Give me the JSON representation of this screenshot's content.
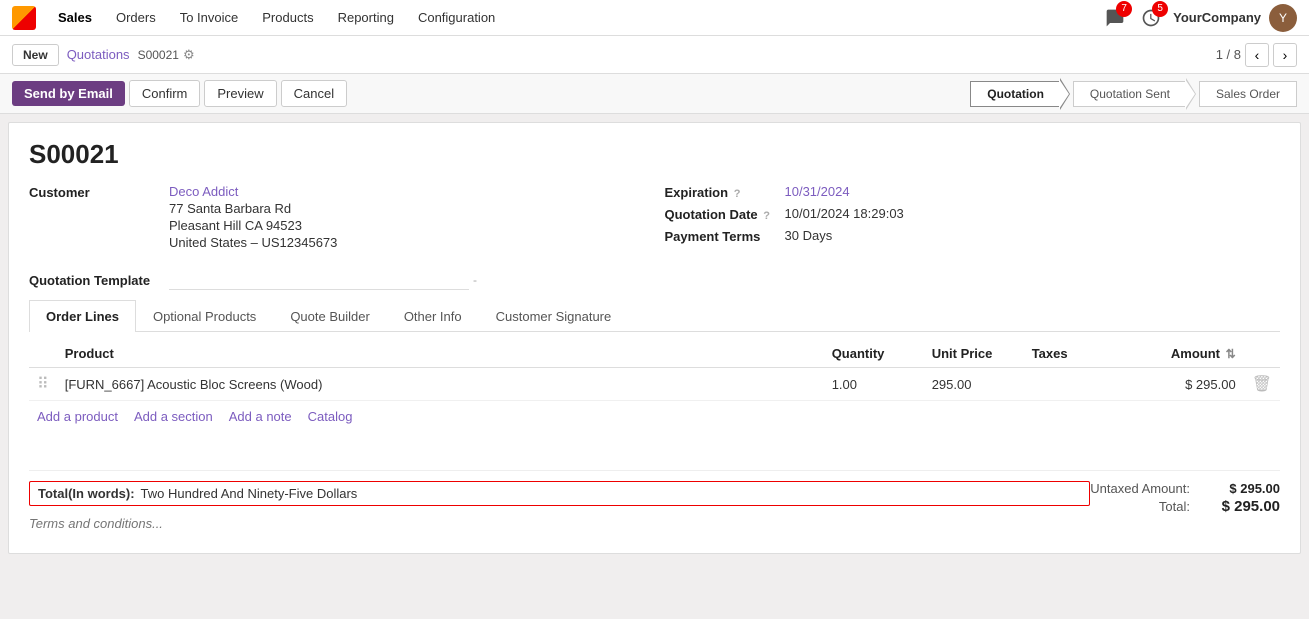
{
  "app": {
    "logo_alt": "Odoo",
    "nav_items": [
      {
        "label": "Sales",
        "active": true
      },
      {
        "label": "Orders"
      },
      {
        "label": "To Invoice"
      },
      {
        "label": "Products"
      },
      {
        "label": "Reporting"
      },
      {
        "label": "Configuration"
      }
    ],
    "notification_badge": "7",
    "clock_badge": "5",
    "company": "YourCompany",
    "avatar_initials": "Y"
  },
  "breadcrumb": {
    "new_label": "New",
    "parent_label": "Quotations",
    "current_id": "S00021",
    "gear_symbol": "⚙"
  },
  "pagination": {
    "current": "1 / 8",
    "prev": "‹",
    "next": "›"
  },
  "actions": {
    "send_by_email": "Send by Email",
    "confirm": "Confirm",
    "preview": "Preview",
    "cancel": "Cancel"
  },
  "status_steps": [
    {
      "label": "Quotation",
      "active": true
    },
    {
      "label": "Quotation Sent",
      "active": false
    },
    {
      "label": "Sales Order",
      "active": false
    }
  ],
  "form": {
    "title": "S00021",
    "customer_label": "Customer",
    "customer_name": "Deco Addict",
    "customer_address1": "77 Santa Barbara Rd",
    "customer_address2": "Pleasant Hill CA 94523",
    "customer_address3": "United States – US12345673",
    "expiration_label": "Expiration",
    "expiration_help": "?",
    "expiration_value": "10/31/2024",
    "quotation_date_label": "Quotation Date",
    "quotation_date_help": "?",
    "quotation_date_value": "10/01/2024 18:29:03",
    "payment_terms_label": "Payment Terms",
    "payment_terms_value": "30 Days",
    "template_label": "Quotation Template",
    "template_placeholder": "-"
  },
  "tabs": [
    {
      "label": "Order Lines",
      "active": true
    },
    {
      "label": "Optional Products",
      "active": false
    },
    {
      "label": "Quote Builder",
      "active": false
    },
    {
      "label": "Other Info",
      "active": false
    },
    {
      "label": "Customer Signature",
      "active": false
    }
  ],
  "table": {
    "columns": [
      "",
      "Product",
      "Quantity",
      "Unit Price",
      "Taxes",
      "",
      "Amount",
      ""
    ],
    "rows": [
      {
        "drag": "⠿",
        "product": "[FURN_6667] Acoustic Bloc Screens (Wood)",
        "quantity": "1.00",
        "unit_price": "295.00",
        "taxes": "",
        "amount": "$ 295.00",
        "delete": "🗑"
      }
    ]
  },
  "add_links": [
    {
      "label": "Add a product"
    },
    {
      "label": "Add a section"
    },
    {
      "label": "Add a note"
    },
    {
      "label": "Catalog"
    }
  ],
  "footer": {
    "total_words_label": "Total(In words):",
    "total_words_value": "Two Hundred And Ninety-Five Dollars",
    "untaxed_label": "Untaxed Amount:",
    "untaxed_value": "$ 295.00",
    "total_label": "Total:",
    "total_value": "$ 295.00",
    "terms_placeholder": "Terms and conditions..."
  }
}
